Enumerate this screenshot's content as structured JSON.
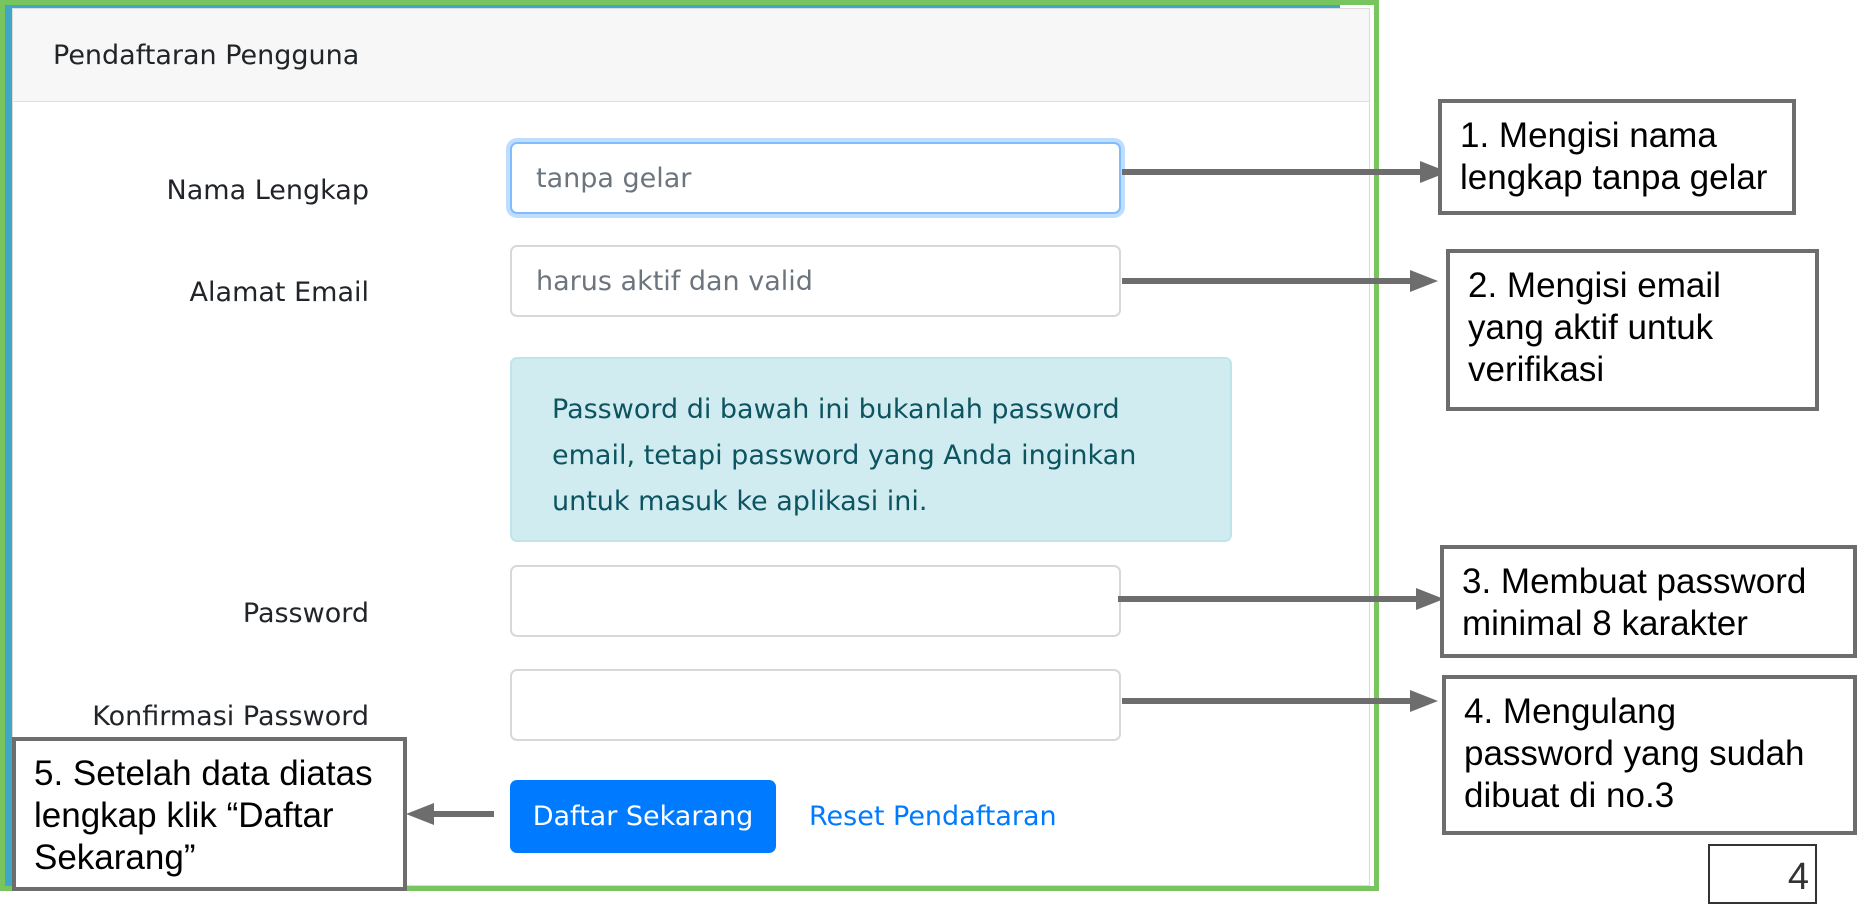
{
  "form": {
    "header": "Pendaftaran Pengguna",
    "full_name": {
      "label": "Nama Lengkap",
      "placeholder": "tanpa gelar",
      "value": ""
    },
    "email": {
      "label": "Alamat Email",
      "placeholder": "harus aktif dan valid",
      "value": ""
    },
    "info_text": "Password di bawah ini bukanlah password email, tetapi password yang Anda inginkan untuk masuk ke aplikasi ini.",
    "password": {
      "label": "Password",
      "value": ""
    },
    "confirm_password": {
      "label": "Konfirmasi Password",
      "value": ""
    },
    "submit_label": "Daftar Sekarang",
    "reset_label": "Reset Pendaftaran"
  },
  "callouts": {
    "c1": "1. Mengisi nama lengkap tanpa gelar",
    "c2": "2. Mengisi email yang aktif untuk verifikasi",
    "c3": "3. Membuat password minimal 8 karakter",
    "c4": "4. Mengulang password yang sudah dibuat di no.3",
    "c5": "5. Setelah data diatas lengkap klik “Daftar Sekarang”"
  },
  "page_number": "4",
  "colors": {
    "primary": "#007bff",
    "info_bg": "#d1ecf1",
    "frame_green": "#78c45e",
    "frame_blue": "#3fa8c9",
    "frame_orange": "#f39c3d",
    "arrow": "#6d6d6d"
  }
}
